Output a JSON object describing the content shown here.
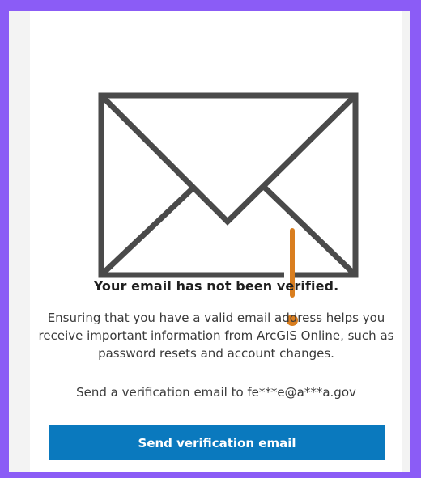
{
  "verification": {
    "title": "Your email has not been verified.",
    "description": "Ensuring that you have a valid email address helps you receive important information from ArcGIS Online, such as password resets and account changes.",
    "send_to_prefix": "Send a verification email to ",
    "masked_email": "fe***e@a***a.gov",
    "button_label": "Send verification email"
  },
  "colors": {
    "button_background": "#0a79be",
    "envelope_stroke": "#4a4a4a",
    "cursor_indicator": "#d97e1f",
    "frame_border": "#8b5cf6"
  },
  "icons": {
    "envelope": "envelope-icon"
  }
}
